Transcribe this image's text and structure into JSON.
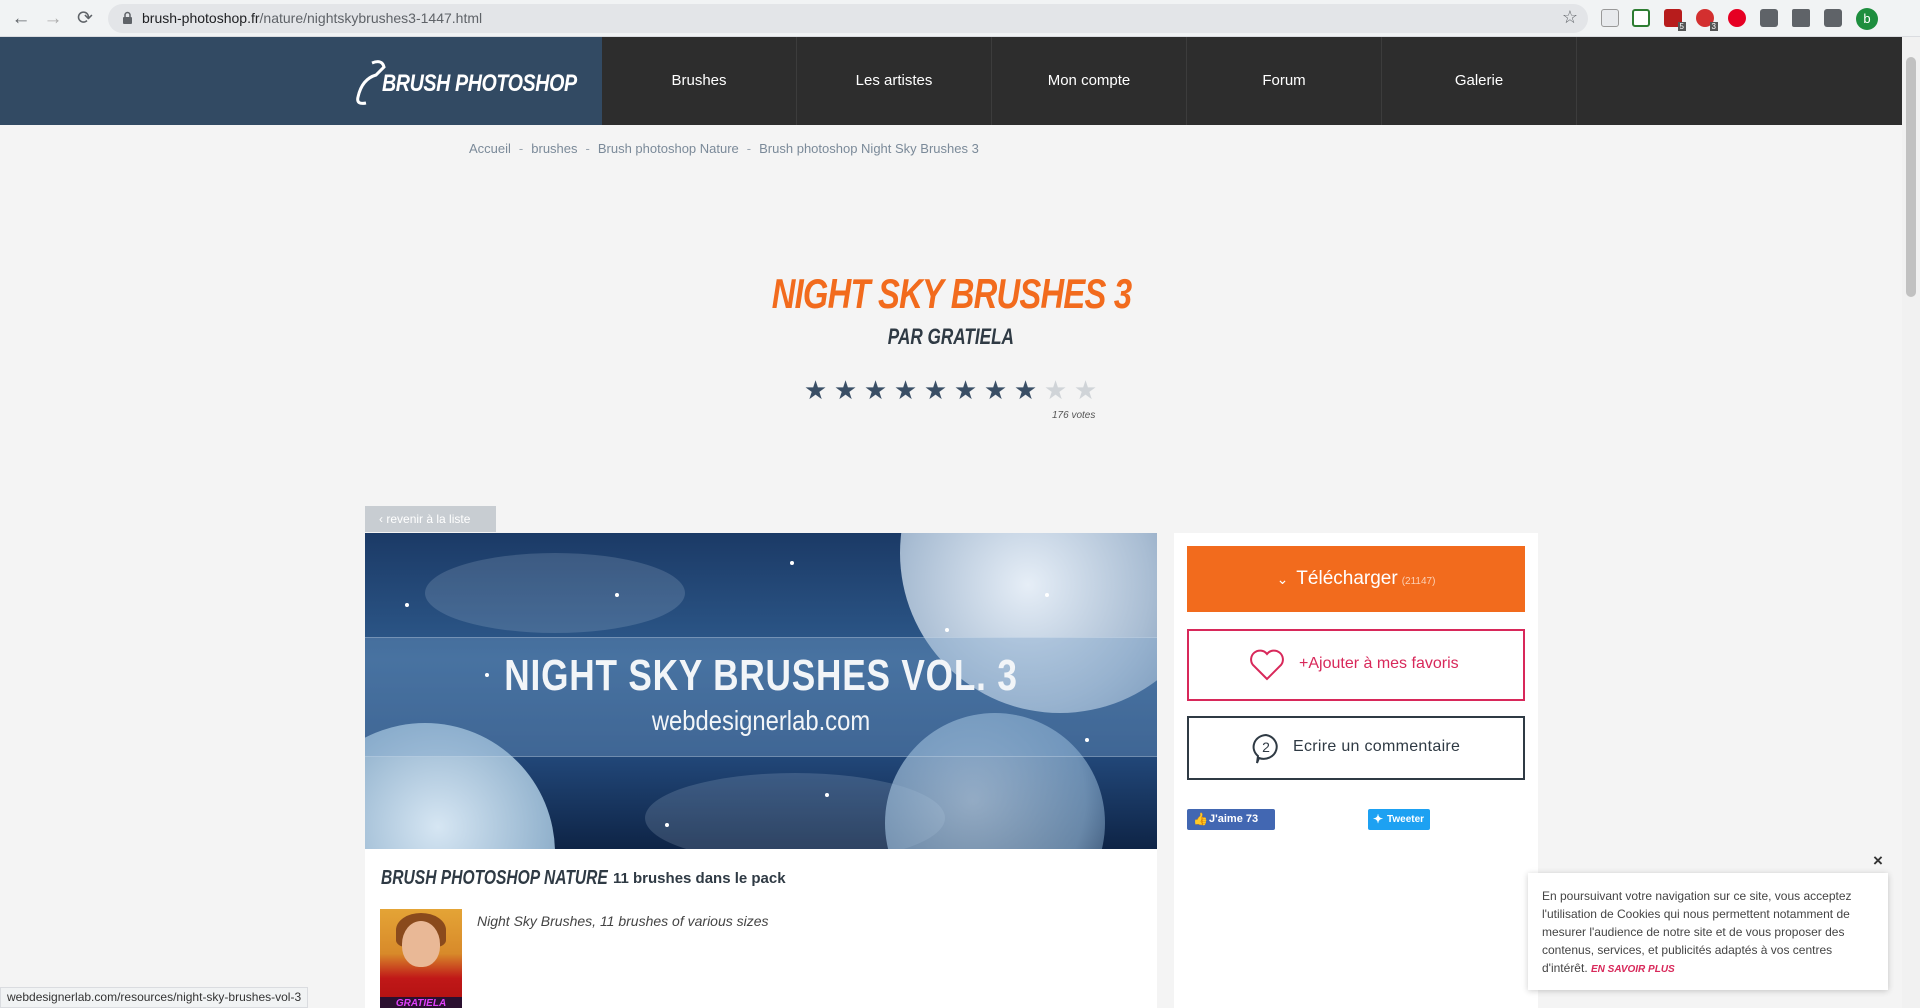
{
  "browser": {
    "url_domain": "brush-photoshop.fr",
    "url_path": "/nature/nightskybrushes3-1447.html",
    "profile_initial": "b",
    "extension_badges": [
      "5",
      "3"
    ]
  },
  "site": {
    "logo_text": "BRUSH PHOTOSHOP",
    "nav": [
      "Brushes",
      "Les artistes",
      "Mon compte",
      "Forum",
      "Galerie"
    ]
  },
  "breadcrumb": [
    "Accueil",
    "brushes",
    "Brush photoshop Nature",
    "Brush photoshop Night Sky Brushes 3"
  ],
  "breadcrumb_sep": "-",
  "title": "NIGHT SKY BRUSHES 3",
  "author": "PAR GRATIELA",
  "rating": {
    "stars_filled": 8,
    "stars_total": 10,
    "votes_text": "176 votes"
  },
  "back_link": "revenir à la liste",
  "hero": {
    "title": "NIGHT SKY  BRUSHES VOL. 3",
    "subtitle": "webdesignerlab.com"
  },
  "details": {
    "category": "BRUSH PHOTOSHOP NATURE",
    "pack_count": "11 brushes dans le pack",
    "avatar_tag": "GRATIELA",
    "description": "Night Sky Brushes, 11 brushes of various sizes"
  },
  "actions": {
    "download_label": "Télécharger",
    "download_count": "(21147)",
    "favorite_label": "+Ajouter à mes favoris",
    "comment_label": "Ecrire un commentaire",
    "comment_count": "2",
    "like_label": "J'aime 73",
    "tweet_label": "Tweeter"
  },
  "cookie": {
    "text": "En poursuivant votre navigation sur ce site, vous acceptez l'utilisation de Cookies qui nous permettent notamment de mesurer l'audience de notre site et de vous proposer des contenus, services, et publicités adaptés à vos centres d'intérêt.",
    "more": "EN SAVOIR PLUS",
    "close": "×"
  },
  "status_url": "webdesignerlab.com/resources/night-sky-brushes-vol-3",
  "colors": {
    "accent": "#f26b1d",
    "header_dark": "#2d2d2d",
    "logo_bg": "#324a63",
    "favorite": "#d8285a",
    "star_filled": "#3a4f66",
    "star_empty": "#d0d4d8"
  }
}
